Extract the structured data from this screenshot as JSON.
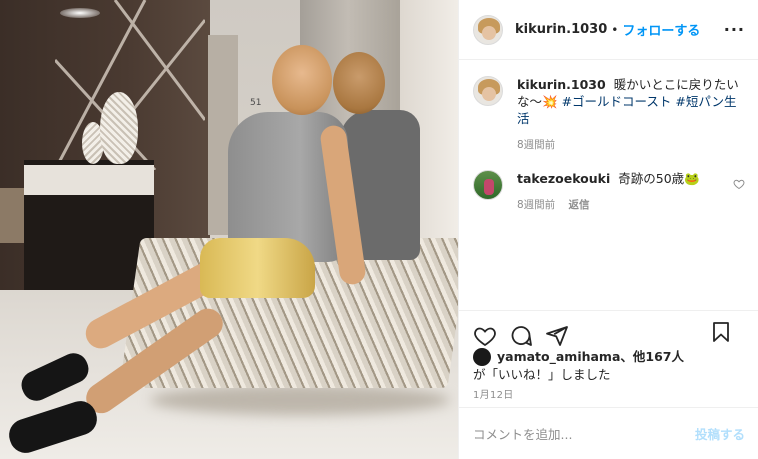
{
  "header": {
    "username": "kikurin.1030",
    "dot": "•",
    "follow_label": "フォローする",
    "more_label": "···"
  },
  "photo": {
    "alt": "post-photo",
    "elevator_sign": "51"
  },
  "caption": {
    "username": "kikurin.1030",
    "text": "暖かいとこに戻りたいな〜💥",
    "tags": [
      "#ゴールドコースト",
      "#短パン生活"
    ],
    "time": "8週間前"
  },
  "comments": [
    {
      "username": "takezoekouki",
      "text": "奇跡の50歳🐸",
      "time": "8週間前",
      "reply_label": "返信"
    }
  ],
  "likes": {
    "first_user": "yamato_amihama",
    "others": "、他167人",
    "suffix": "が「いいね！」しました"
  },
  "date": "1月12日",
  "add_comment": {
    "placeholder": "コメントを追加...",
    "post_label": "投稿する"
  },
  "colors": {
    "accent": "#0095f6",
    "post_disabled": "#b2dffc",
    "muted": "#8e8e8e",
    "text": "#262626",
    "tag": "#00376b"
  },
  "icons": [
    "heart-icon",
    "comment-icon",
    "share-icon",
    "bookmark-icon",
    "more-icon",
    "small-heart-icon"
  ]
}
